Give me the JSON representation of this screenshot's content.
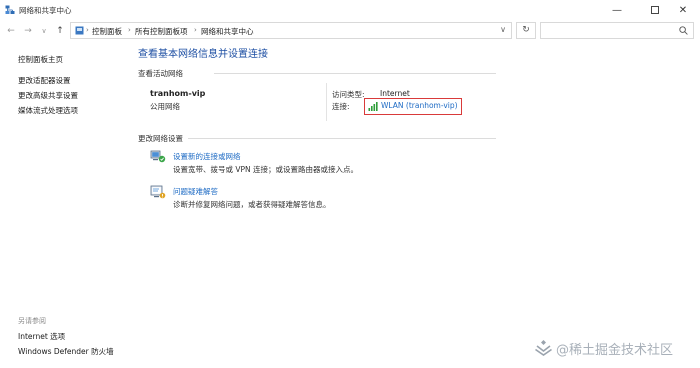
{
  "window": {
    "title": "网络和共享中心",
    "controls": [
      "minimize-icon",
      "maximize-icon",
      "close-icon"
    ]
  },
  "address_bar": {
    "back": "←",
    "forward": "→",
    "recent": "∨",
    "up": "↑",
    "crumbs": [
      "控制面板",
      "所有控制面板项",
      "网络和共享中心"
    ],
    "search_placeholder": ""
  },
  "sidebar": {
    "home_link": "控制面板主页",
    "links": [
      "更改适配器设置",
      "更改高级共享设置",
      "媒体流式处理选项"
    ],
    "see_also_label": "另请参阅",
    "see_also_links": [
      "Internet 选项",
      "Windows Defender 防火墙"
    ]
  },
  "main": {
    "title": "查看基本网络信息并设置连接",
    "active_networks_heading": "查看活动网络",
    "network": {
      "name": "tranhom-vip",
      "category": "公用网络",
      "access_type_label": "访问类型:",
      "access_type_value": "Internet",
      "connection_label": "连接:",
      "connection_value": "WLAN (tranhom-vip)"
    },
    "change_settings_heading": "更改网络设置",
    "tasks": [
      {
        "icon": "network-setup-icon",
        "link": "设置新的连接或网络",
        "desc": "设置宽带、拨号或 VPN 连接；或设置路由器或接入点。"
      },
      {
        "icon": "troubleshoot-icon",
        "link": "问题疑难解答",
        "desc": "诊断并修复网络问题，或者获得疑难解答信息。"
      }
    ]
  },
  "watermark": "@稀土掘金技术社区",
  "colors": {
    "link": "#1e6bc4",
    "title": "#1e4fa3",
    "highlight_border": "#d93a3a"
  }
}
